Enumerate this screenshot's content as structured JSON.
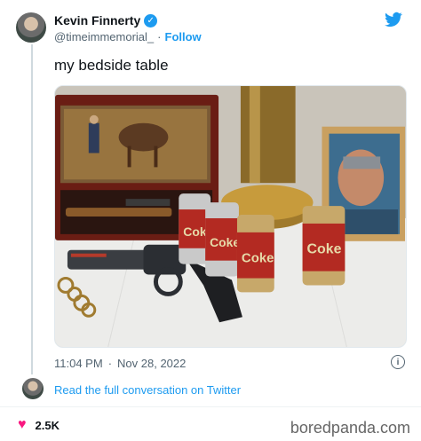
{
  "author": {
    "name": "Kevin Finnerty",
    "handle": "@timeimmemorial_",
    "separator": "·",
    "follow_label": "Follow",
    "verified_icon": "check-icon"
  },
  "tweet": {
    "text": "my bedside table"
  },
  "media": {
    "cans": [
      "Coke",
      "Coke",
      "Coke",
      "Coke"
    ]
  },
  "meta": {
    "time": "11:04 PM",
    "separator": "·",
    "date": "Nov 28, 2022"
  },
  "conversation_link": "Read the full conversation on Twitter",
  "likes": {
    "count": "2.5K"
  },
  "watermark": "boredpanda.com",
  "colors": {
    "accent": "#1d9bf0",
    "like": "#f91880",
    "muted": "#536471"
  }
}
